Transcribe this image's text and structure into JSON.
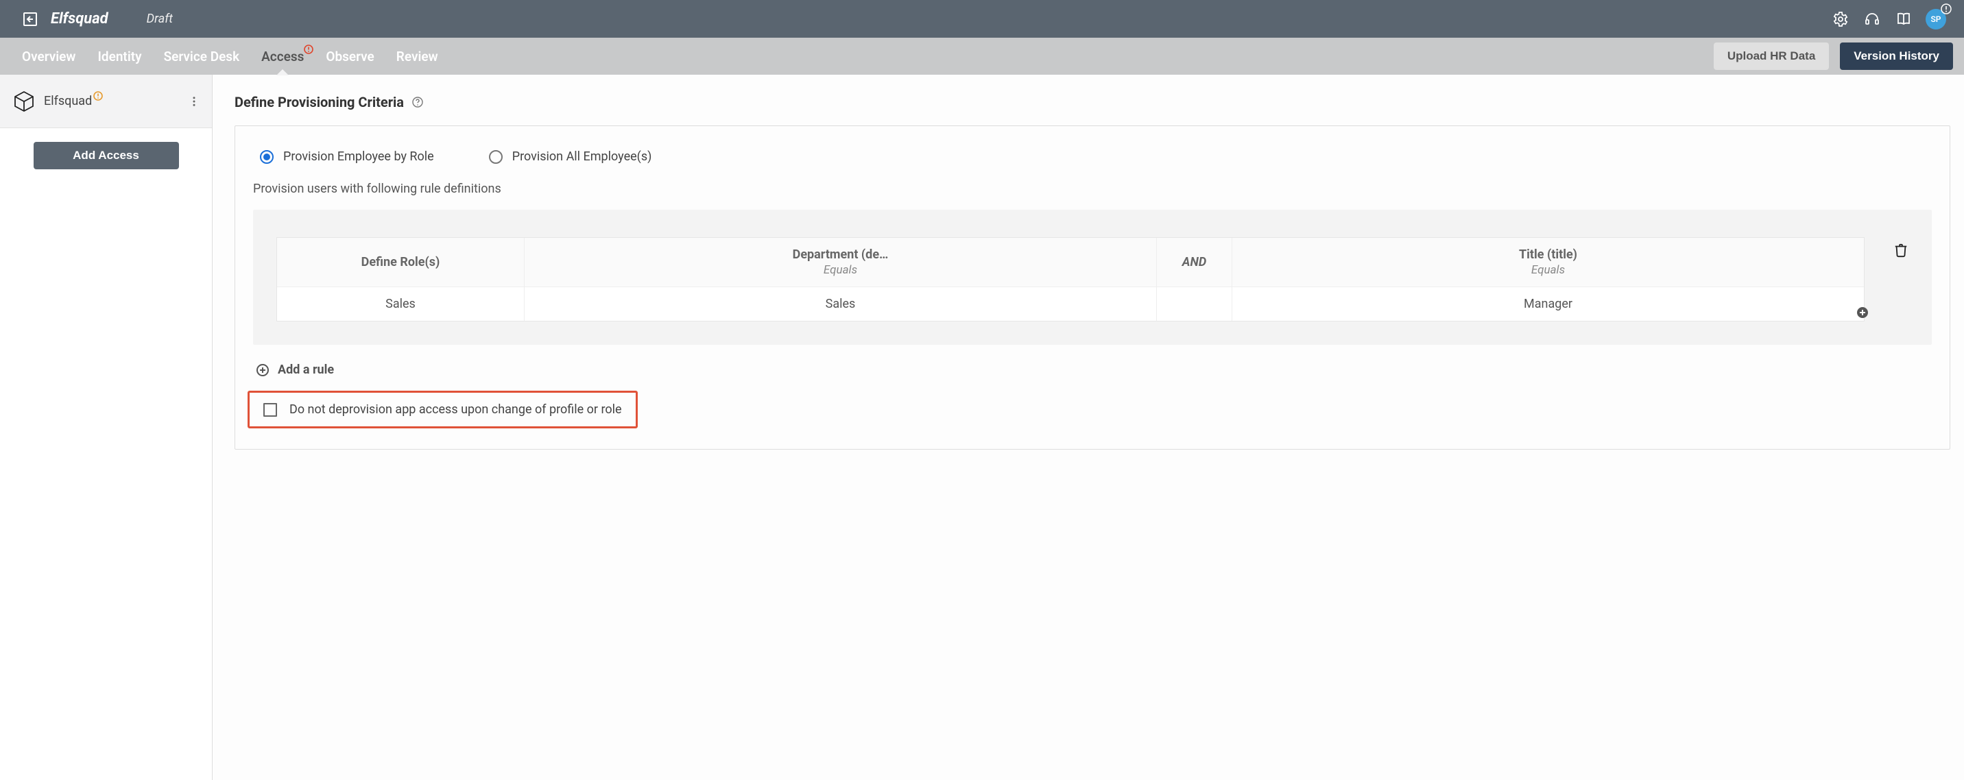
{
  "header": {
    "brand": "Elfsquad",
    "status": "Draft",
    "avatar_initials": "SP"
  },
  "tabs": {
    "items": [
      {
        "label": "Overview"
      },
      {
        "label": "Identity"
      },
      {
        "label": "Service Desk"
      },
      {
        "label": "Access",
        "active": true,
        "alert": true
      },
      {
        "label": "Observe"
      },
      {
        "label": "Review"
      }
    ],
    "upload_label": "Upload HR Data",
    "version_label": "Version History"
  },
  "sidebar": {
    "app_name": "Elfsquad",
    "app_alert": true,
    "add_access_label": "Add Access"
  },
  "main": {
    "title": "Define Provisioning Criteria",
    "radio_by_role": "Provision Employee by Role",
    "radio_all": "Provision All Employee(s)",
    "rule_intro": "Provision users with following rule definitions",
    "table": {
      "col_role": "Define Role(s)",
      "col_dept": "Department (de…",
      "col_dept_sub": "Equals",
      "col_and": "AND",
      "col_title": "Title (title)",
      "col_title_sub": "Equals",
      "row": {
        "role": "Sales",
        "dept": "Sales",
        "title": "Manager"
      }
    },
    "add_rule": "Add a rule",
    "deprov_label": "Do not deprovision app access upon change of profile or role"
  }
}
